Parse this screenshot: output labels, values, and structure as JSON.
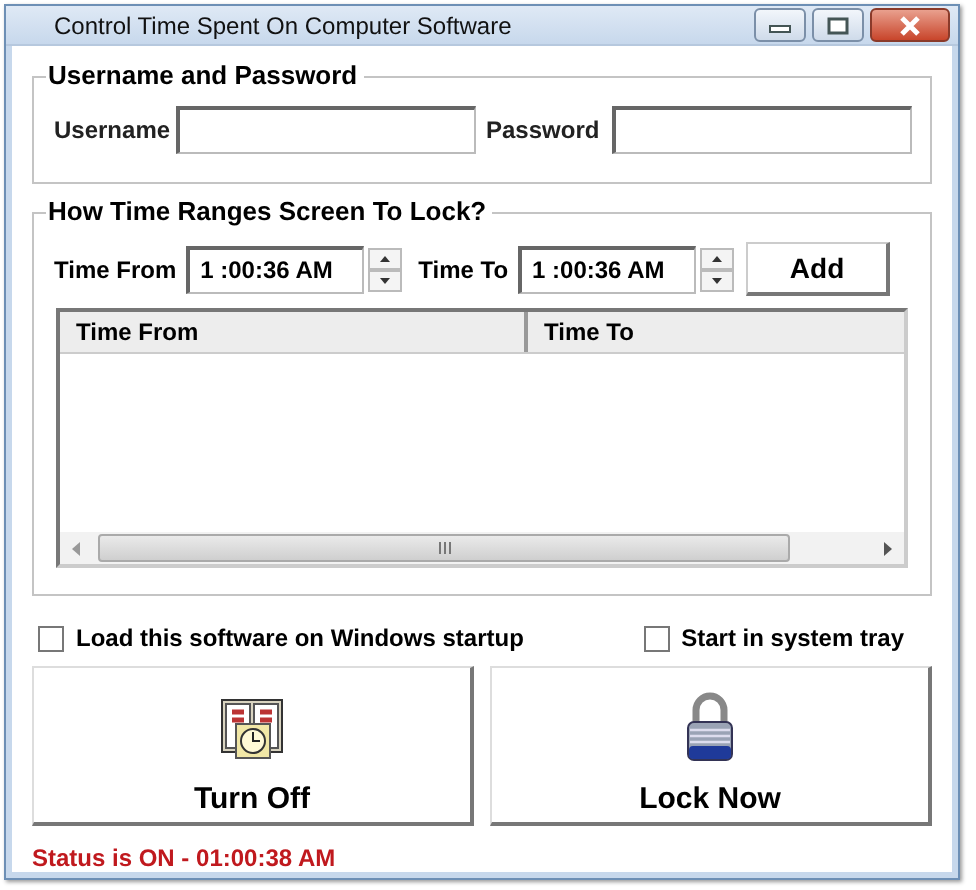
{
  "window": {
    "title": "Control Time Spent On Computer Software"
  },
  "credentials": {
    "title": "Username and Password",
    "fields": [
      {
        "label": "Username"
      },
      {
        "label": "Password"
      }
    ]
  },
  "time_ranges": {
    "title": "How Time Ranges Screen To Lock?",
    "inputs": [
      {
        "label": "Time From",
        "value": "1 :00:36 AM"
      },
      {
        "label": "Time To",
        "value": "1 :00:36 AM"
      }
    ],
    "add_button": "Add",
    "table": {
      "columns": [
        "Time From",
        "Time To"
      ]
    }
  },
  "options": [
    {
      "label": "Load this software on Windows startup",
      "checked": false
    },
    {
      "label": "Start in system tray",
      "checked": false
    }
  ],
  "actions": [
    {
      "label": "Turn Off",
      "kind": "calendar"
    },
    {
      "label": "Lock Now",
      "kind": "lock"
    }
  ],
  "status": "Status is ON - 01:00:38 AM"
}
